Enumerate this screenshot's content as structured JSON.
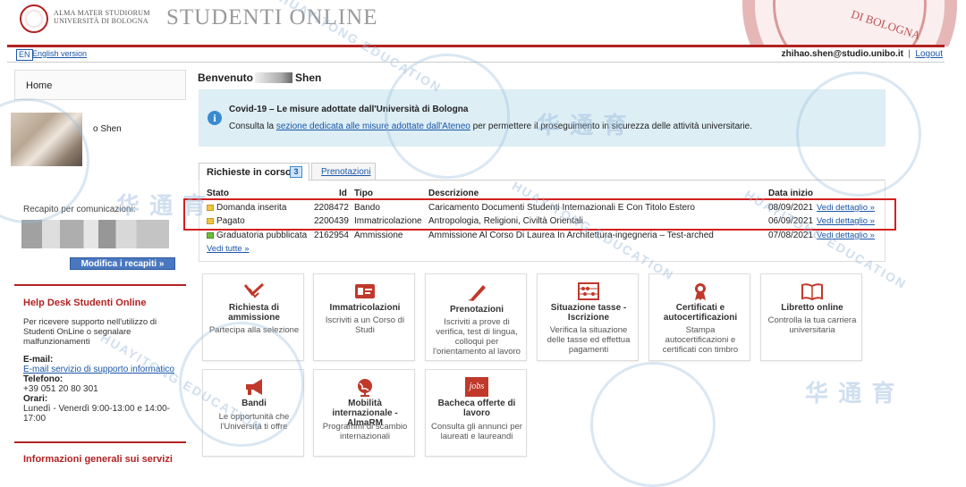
{
  "header": {
    "logo_line1": "ALMA MATER STUDIORUM",
    "logo_line2": "UNIVERSITÀ DI BOLOGNA",
    "app_title": "STUDENTI ONLINE",
    "seal_text": "DI BOLOGNA"
  },
  "topbar": {
    "lang_badge": "EN",
    "lang_link": "English version",
    "user_email": "zhihao.shen@studio.unibo.it",
    "separator": "|",
    "logout": "Logout"
  },
  "sidebar": {
    "home": "Home",
    "profile_name": "o Shen",
    "recapito_label": "Recapito per comunicazioni:",
    "modifica_button": "Modifica i recapiti »",
    "help": {
      "title": "Help Desk Studenti Online",
      "text": "Per ricevere supporto nell'utilizzo di Studenti OnLine o segnalare malfunzionamenti",
      "email_label": "E-mail:",
      "email_link": "E-mail servizio di supporto informatico",
      "phone_label": "Telefono:",
      "phone": "+39 051 20 80 301",
      "hours_label": "Orari:",
      "hours": "Lunedì - Venerdì 9:00-13:00 e 14:00-17:00"
    },
    "info_title": "Informazioni generali sui servizi"
  },
  "main": {
    "welcome": "Benvenuto",
    "welcome_name": "Shen",
    "notice": {
      "icon": "info-icon",
      "title": "Covid-19 – Le misure adottate dall'Università di Bologna",
      "body_before": "Consulta la ",
      "body_link": "sezione dedicata alle misure adottate dall'Ateneo",
      "body_after": " per permettere il proseguimento in sicurezza delle attività universitarie."
    },
    "tabs": [
      {
        "label": "Richieste in corso",
        "count": "3"
      },
      {
        "label": "Prenotazioni"
      }
    ],
    "table": {
      "headers": [
        "Stato",
        "Id",
        "Tipo",
        "Descrizione",
        "Data inizio"
      ],
      "rows": [
        {
          "stato": "Domanda inserita",
          "id": "2208472",
          "tipo": "Bando",
          "descrizione": "Caricamento Documenti Studenti Internazionali E Con Titolo Estero",
          "data": "08/09/2021",
          "link": "Vedi dettaglio »",
          "status_color": "yellow"
        },
        {
          "stato": "Pagato",
          "id": "2200439",
          "tipo": "Immatricolazione",
          "descrizione": "Antropologia, Religioni, Civiltà Orientali",
          "data": "06/09/2021",
          "link": "Vedi dettaglio »",
          "status_color": "yellow"
        },
        {
          "stato": "Graduatoria pubblicata",
          "id": "2162954",
          "tipo": "Ammissione",
          "descrizione": "Ammissione Al Corso Di Laurea In Architettura-ingegneria – Test-arched",
          "data": "07/08/2021",
          "link": "Vedi dettaglio »",
          "status_color": "green"
        }
      ],
      "see_all": "Vedi tutte »"
    },
    "cards": [
      {
        "icon": "checkmark-icon",
        "title": "Richiesta di ammissione",
        "desc": "Partecipa alla selezione"
      },
      {
        "icon": "id-card-icon",
        "title": "Immatricolazioni",
        "desc": "Iscriviti a un Corso di Studi"
      },
      {
        "icon": "pen-icon",
        "title": "Prenotazioni",
        "desc": "Iscriviti a prove di verifica, test di lingua, colloqui per l'orientamento al lavoro"
      },
      {
        "icon": "abacus-icon",
        "title": "Situazione tasse - Iscrizione",
        "desc": "Verifica la situazione delle tasse ed effettua pagamenti"
      },
      {
        "icon": "ribbon-icon",
        "title": "Certificati e autocertificazioni",
        "desc": "Stampa autocertificazioni e certificati con timbro"
      },
      {
        "icon": "book-icon",
        "title": "Libretto online",
        "desc": "Controlla la tua carriera universitaria"
      },
      {
        "icon": "megaphone-icon",
        "title": "Bandi",
        "desc": "Le opportunità che l'Università ti offre"
      },
      {
        "icon": "globe-icon",
        "title": "Mobilità internazionale - AlmaRM",
        "desc": "Programmi di scambio internazionali"
      },
      {
        "icon": "jobs-icon",
        "title": "Bacheca offerte di lavoro",
        "desc": "Consulta gli annunci per laureati e laureandi",
        "icon_text": "jobs"
      }
    ]
  },
  "watermark": {
    "text": "HUAYITONG EDUCATION",
    "chars": "华 通 育"
  },
  "colors": {
    "brand_red": "#b22222",
    "link_blue": "#1a56a8",
    "notice_bg": "#ddeef5",
    "highlight_red": "#d42020"
  }
}
